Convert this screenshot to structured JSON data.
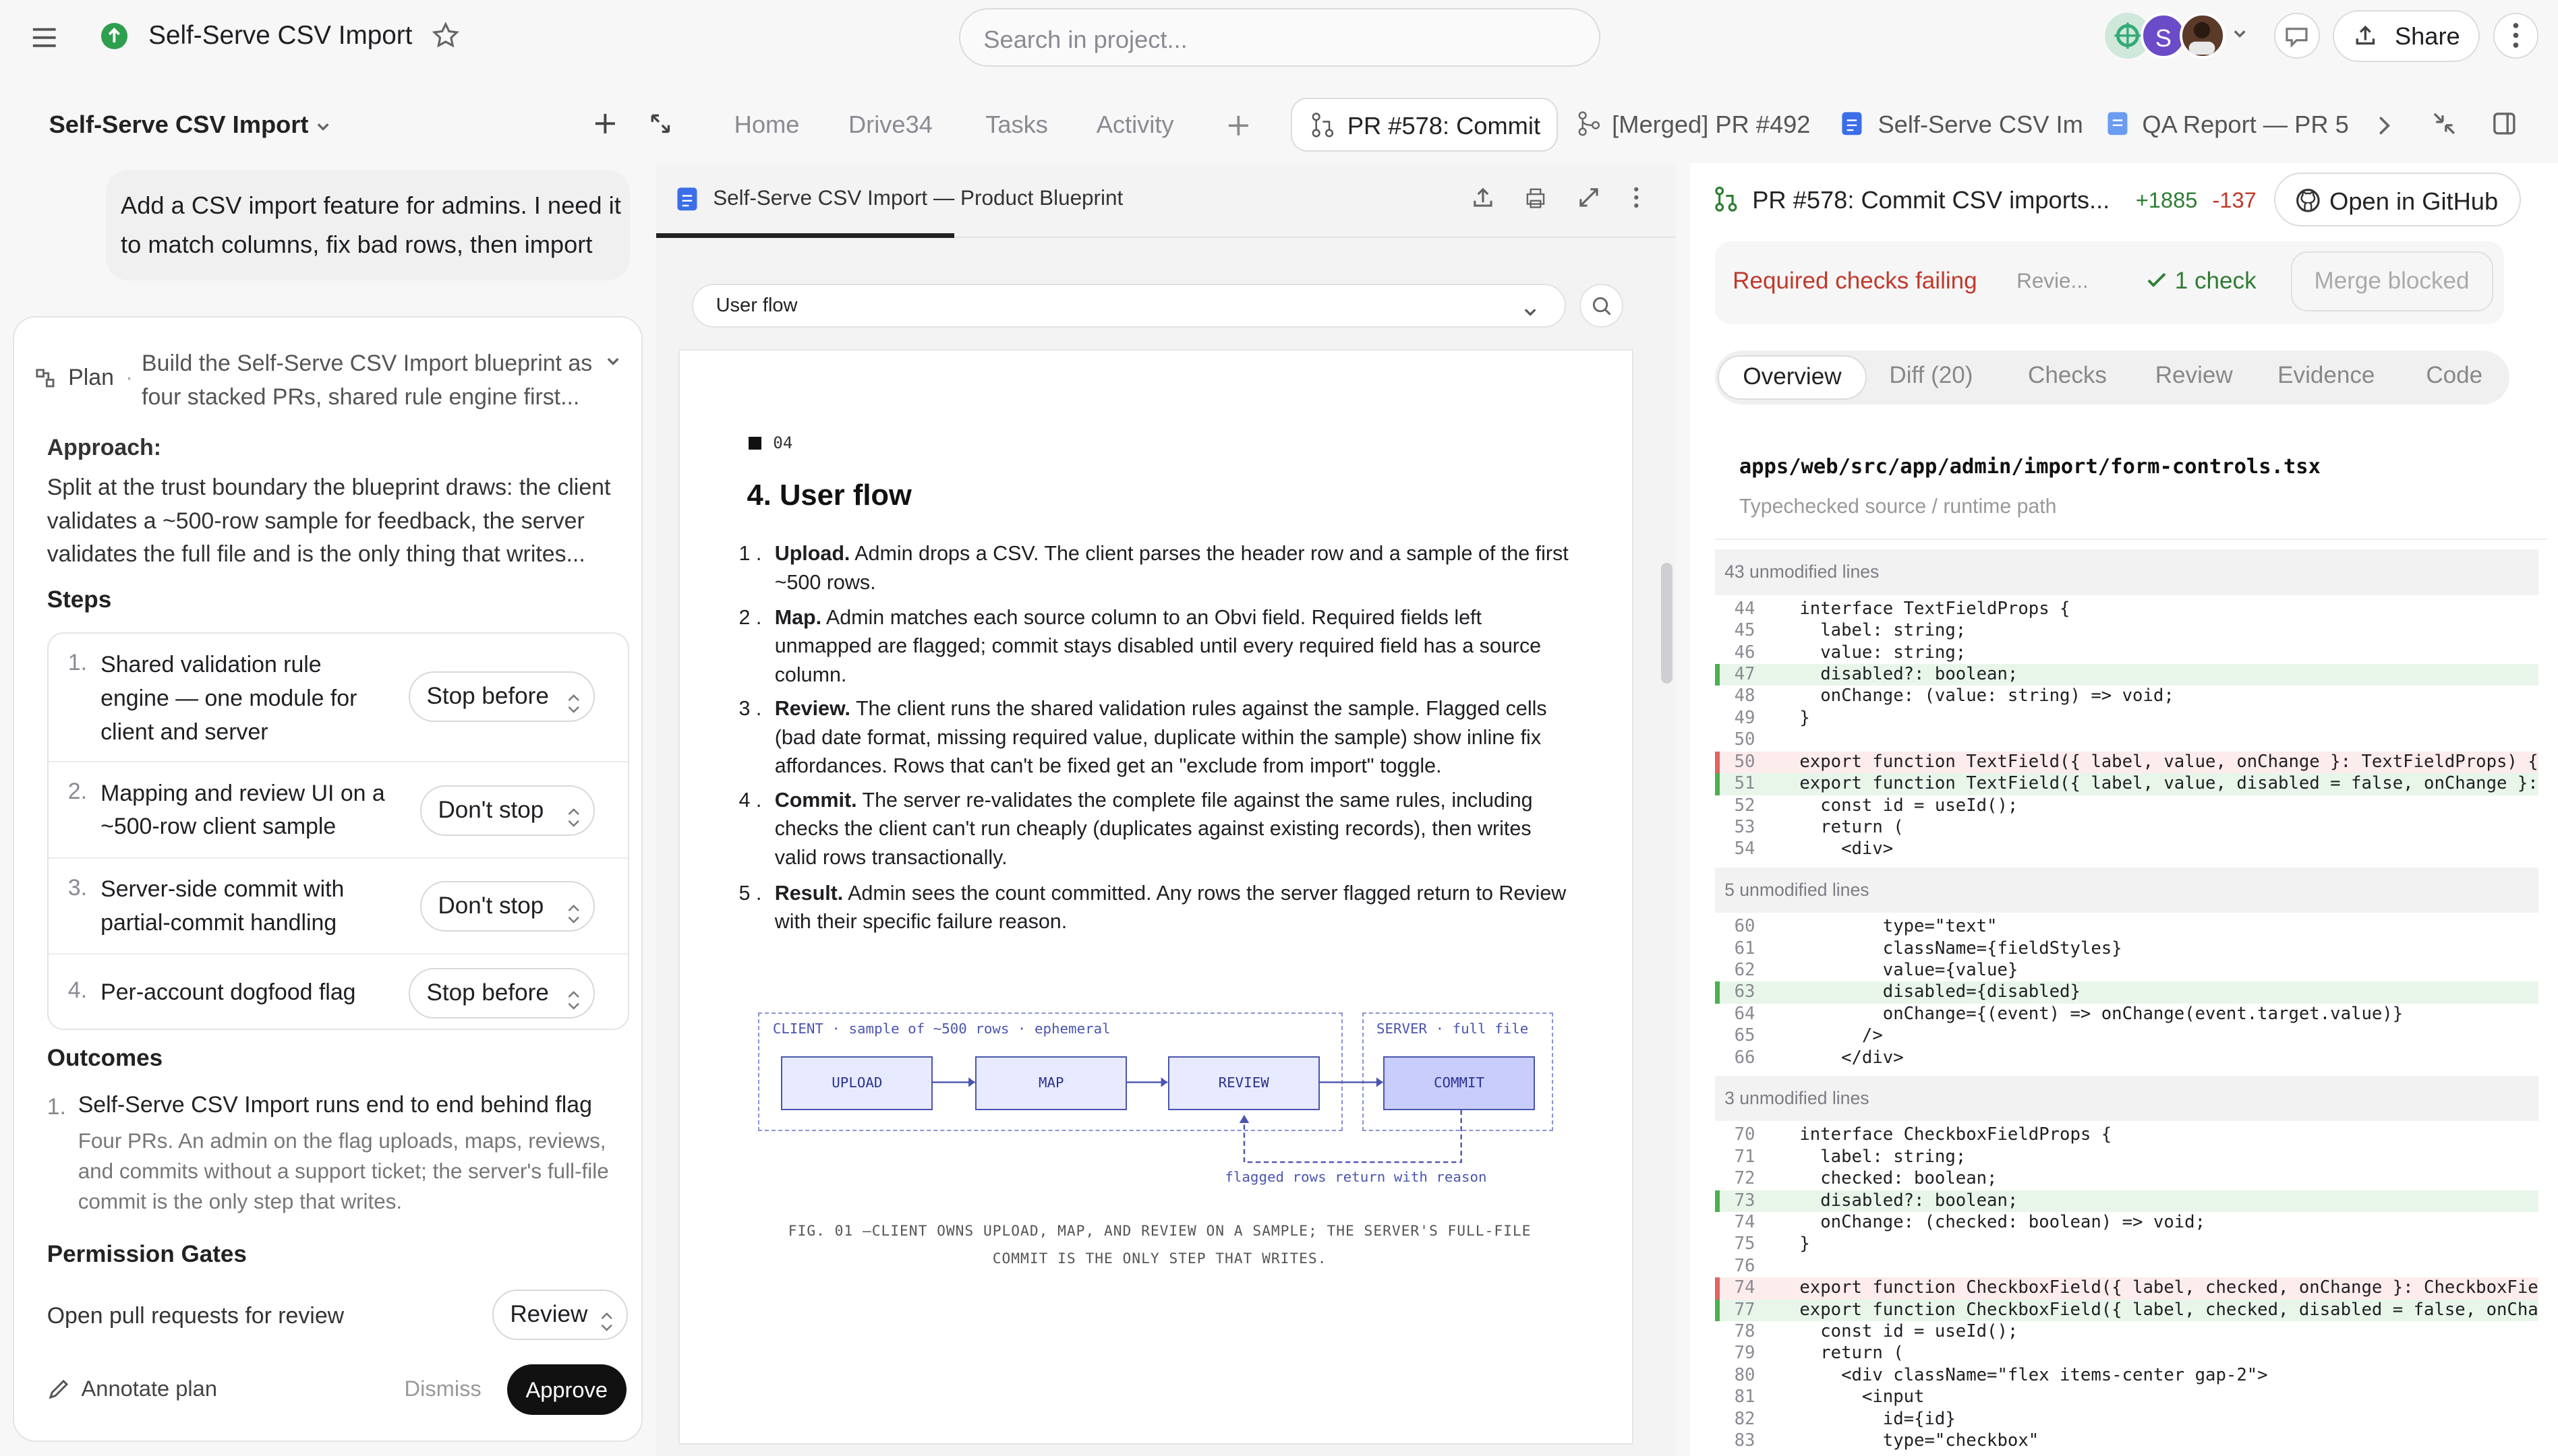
{
  "topbar": {
    "project": "Self-Serve CSV Import",
    "search_placeholder": "Search in project...",
    "avatar_letter": "S",
    "share": "Share"
  },
  "nav": {
    "project": "Self-Serve CSV Import",
    "tabs": [
      "Home",
      "Drive34",
      "Tasks",
      "Activity"
    ],
    "doc_tabs": [
      "PR #578: Commit",
      "[Merged] PR #492",
      "Self-Serve CSV Im",
      "QA Report — PR 5"
    ]
  },
  "chat": {
    "message": "Add a CSV import feature for admins. I need it to match columns, fix bad rows, then import"
  },
  "plan": {
    "label": "Plan",
    "summary": "Build the Self-Serve CSV Import blueprint as four stacked PRs, shared rule engine first...",
    "approach_title": "Approach:",
    "approach": "Split at the trust boundary the blueprint draws: the client validates a ~500-row sample for feedback, the server validates the full file and is the only thing that writes...",
    "steps_title": "Steps",
    "steps": [
      {
        "n": "1.",
        "text": "Shared validation rule engine — one module for client and server",
        "stop": "Stop before"
      },
      {
        "n": "2.",
        "text": "Mapping and review UI on a ~500-row client sample",
        "stop": "Don't stop"
      },
      {
        "n": "3.",
        "text": "Server-side commit with partial-commit handling",
        "stop": "Don't stop"
      },
      {
        "n": "4.",
        "text": "Per-account dogfood flag",
        "stop": "Stop before"
      }
    ],
    "outcomes_title": "Outcomes",
    "outcome_n": "1.",
    "outcome_title": "Self-Serve CSV Import runs end to end behind flag",
    "outcome_desc": "Four PRs. An admin on the flag uploads, maps, reviews, and commits without a support ticket; the server's full-file commit is the only step that writes.",
    "gates_title": "Permission Gates",
    "gate_label": "Open pull requests for review",
    "gate_value": "Review",
    "annotate": "Annotate plan",
    "dismiss": "Dismiss",
    "approve": "Approve"
  },
  "doc": {
    "tab": "Self-Serve CSV Import — Product Blueprint",
    "section_select": "User flow",
    "kicker": "04",
    "heading": "4. User flow",
    "items": [
      {
        "n": "1 .",
        "b": "Upload.",
        "t": " Admin drops a CSV. The client parses the header row and a sample of the first ~500 rows."
      },
      {
        "n": "2 .",
        "b": "Map.",
        "t": " Admin matches each source column to an Obvi field. Required fields left unmapped are flagged; commit stays disabled until every required field has a source column."
      },
      {
        "n": "3 .",
        "b": "Review.",
        "t": " The client runs the shared validation rules against the sample. Flagged cells (bad date format, missing required value, duplicate within the sample) show inline fix affordances. Rows that can't be fixed get an \"exclude from import\" toggle."
      },
      {
        "n": "4 .",
        "b": "Commit.",
        "t": " The server re-validates the complete file against the same rules, including checks the client can't run cheaply (duplicates against existing records), then writes valid rows transactionally."
      },
      {
        "n": "5 .",
        "b": "Result.",
        "t": " Admin sees the count committed. Any rows the server flagged return to Review with their specific failure reason."
      }
    ],
    "diagram": {
      "client_label": "CLIENT · sample of ~500 rows · ephemeral",
      "server_label": "SERVER · full file",
      "boxes": [
        "UPLOAD",
        "MAP",
        "REVIEW",
        "COMMIT"
      ],
      "return_label": "flagged rows return with reason",
      "fig": "FIG. 01 —CLIENT OWNS UPLOAD, MAP, AND REVIEW ON A SAMPLE; THE SERVER'S FULL-FILE",
      "fig2": "COMMIT IS THE ONLY STEP THAT WRITES."
    }
  },
  "pr": {
    "title": "PR #578: Commit CSV imports...",
    "adds": "+1885",
    "dels": "-137",
    "github": "Open in GitHub",
    "checks_failing": "Required checks failing",
    "review": "Revie...",
    "check_ok": "1 check",
    "merge": "Merge blocked",
    "tabs": [
      "Overview",
      "Diff (20)",
      "Checks",
      "Review",
      "Evidence",
      "Code"
    ],
    "file": "apps/web/src/app/admin/import/form-controls.tsx",
    "file_sub": "Typechecked source / runtime path",
    "hunks": [
      "43 unmodified lines",
      "5 unmodified lines",
      "3 unmodified lines"
    ],
    "block1": [
      [
        "44",
        "interface TextFieldProps {",
        ""
      ],
      [
        "45",
        "  label: string;",
        ""
      ],
      [
        "46",
        "  value: string;",
        ""
      ],
      [
        "47",
        "  disabled?: boolean;",
        "add"
      ],
      [
        "48",
        "  onChange: (value: string) => void;",
        ""
      ],
      [
        "49",
        "}",
        ""
      ],
      [
        "50",
        "",
        ""
      ],
      [
        "50",
        "export function TextField({ label, value, onChange }: TextFieldProps) {",
        "del"
      ],
      [
        "51",
        "export function TextField({ label, value, disabled = false, onChange }: Te",
        "add"
      ],
      [
        "52",
        "  const id = useId();",
        ""
      ],
      [
        "53",
        "  return (",
        ""
      ],
      [
        "54",
        "    <div>",
        ""
      ]
    ],
    "block2": [
      [
        "60",
        "        type=\"text\"",
        ""
      ],
      [
        "61",
        "        className={fieldStyles}",
        ""
      ],
      [
        "62",
        "        value={value}",
        ""
      ],
      [
        "63",
        "        disabled={disabled}",
        "add"
      ],
      [
        "64",
        "        onChange={(event) => onChange(event.target.value)}",
        ""
      ],
      [
        "65",
        "      />",
        ""
      ],
      [
        "66",
        "    </div>",
        ""
      ]
    ],
    "block3": [
      [
        "70",
        "interface CheckboxFieldProps {",
        ""
      ],
      [
        "71",
        "  label: string;",
        ""
      ],
      [
        "72",
        "  checked: boolean;",
        ""
      ],
      [
        "73",
        "  disabled?: boolean;",
        "add"
      ],
      [
        "74",
        "  onChange: (checked: boolean) => void;",
        ""
      ],
      [
        "75",
        "}",
        ""
      ],
      [
        "76",
        "",
        ""
      ],
      [
        "74",
        "export function CheckboxField({ label, checked, onChange }: CheckboxFieldP",
        "del"
      ],
      [
        "77",
        "export function CheckboxField({ label, checked, disabled = false, onChange",
        "add"
      ],
      [
        "78",
        "  const id = useId();",
        ""
      ],
      [
        "79",
        "  return (",
        ""
      ],
      [
        "80",
        "    <div className=\"flex items-center gap-2\">",
        ""
      ],
      [
        "81",
        "      <input",
        ""
      ],
      [
        "82",
        "        id={id}",
        ""
      ],
      [
        "83",
        "        type=\"checkbox\"",
        ""
      ]
    ]
  }
}
